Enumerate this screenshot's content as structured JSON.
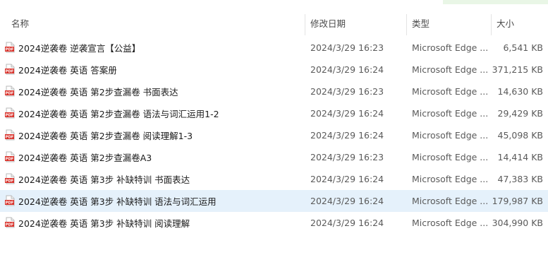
{
  "columns": {
    "name": "名称",
    "date": "修改日期",
    "type": "类型",
    "size": "大小"
  },
  "icon": "pdf-file-icon",
  "colors": {
    "selected_row": "#e5f1fb",
    "pdf_red": "#d9322b"
  },
  "files": [
    {
      "name": "2024逆袭卷  逆袭宣言【公益】",
      "date": "2024/3/29 16:23",
      "type": "Microsoft Edge ...",
      "size": "6,541 KB",
      "selected": false
    },
    {
      "name": "2024逆袭卷  英语   答案册",
      "date": "2024/3/29 16:24",
      "type": "Microsoft Edge ...",
      "size": "371,215 KB",
      "selected": false
    },
    {
      "name": "2024逆袭卷  英语   第2步查漏卷  书面表达",
      "date": "2024/3/29 16:23",
      "type": "Microsoft Edge ...",
      "size": "14,630 KB",
      "selected": false
    },
    {
      "name": "2024逆袭卷  英语   第2步查漏卷  语法与词汇运用1-2",
      "date": "2024/3/29 16:24",
      "type": "Microsoft Edge ...",
      "size": "29,429 KB",
      "selected": false
    },
    {
      "name": "2024逆袭卷  英语   第2步查漏卷  阅读理解1-3",
      "date": "2024/3/29 16:24",
      "type": "Microsoft Edge ...",
      "size": "45,098 KB",
      "selected": false
    },
    {
      "name": "2024逆袭卷  英语   第2步查漏卷A3",
      "date": "2024/3/29 16:23",
      "type": "Microsoft Edge ...",
      "size": "14,414 KB",
      "selected": false
    },
    {
      "name": "2024逆袭卷  英语   第3步 补缺特训  书面表达",
      "date": "2024/3/29 16:24",
      "type": "Microsoft Edge ...",
      "size": "47,383 KB",
      "selected": false
    },
    {
      "name": "2024逆袭卷  英语   第3步 补缺特训  语法与词汇运用",
      "date": "2024/3/29 16:24",
      "type": "Microsoft Edge ...",
      "size": "179,987 KB",
      "selected": true
    },
    {
      "name": "2024逆袭卷  英语   第3步 补缺特训  阅读理解",
      "date": "2024/3/29 16:24",
      "type": "Microsoft Edge ...",
      "size": "304,990 KB",
      "selected": false
    }
  ]
}
